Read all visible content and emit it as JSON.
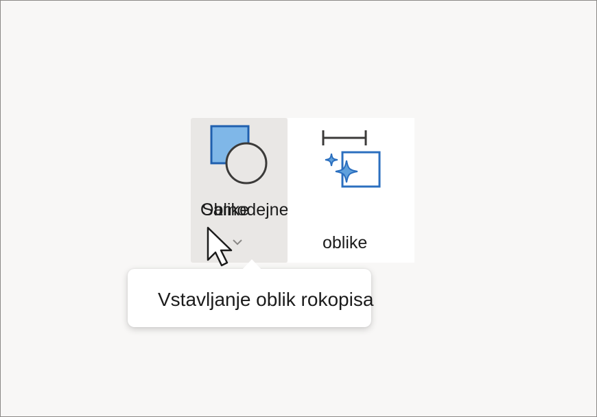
{
  "ribbon": {
    "shapes_button": {
      "label": "Oblike",
      "overlapping_label": "Samodejne",
      "icon": "shapes-icon",
      "dropdown_icon": "chevron-down-icon"
    },
    "morph_button": {
      "label": "oblike",
      "icon": "ink-to-shape-sparkle-icon"
    }
  },
  "tooltip": {
    "text": "Vstavljanje oblik rokopisa"
  },
  "colors": {
    "accent_blue": "#2b6fbf",
    "accent_fill": "#7fb7e8",
    "background": "#f8f7f6",
    "button_hover": "#e9e7e5"
  }
}
